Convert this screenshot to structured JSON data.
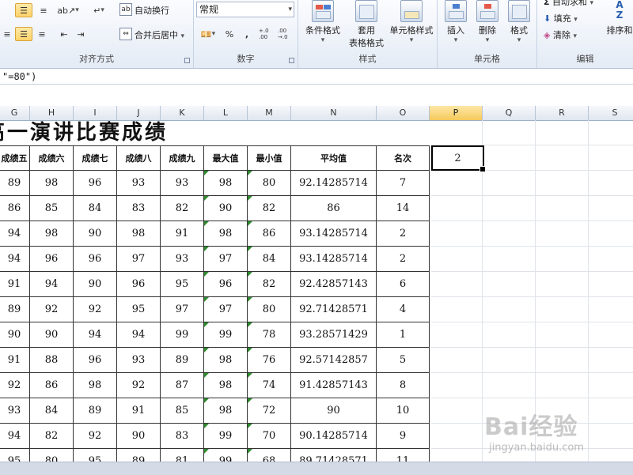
{
  "ribbon": {
    "alignment": {
      "wrap_text": "自动换行",
      "merge_center": "合并后居中",
      "group_label": "对齐方式"
    },
    "number": {
      "format_value": "常规",
      "percent": "%",
      "comma": ",",
      "inc_decimal": "+.0 .00",
      "dec_decimal": ".00 →.0",
      "group_label": "数字"
    },
    "styles": {
      "conditional_format": "条件格式",
      "format_as_table_line1": "套用",
      "format_as_table_line2": "表格格式",
      "cell_styles": "单元格样式",
      "group_label": "样式"
    },
    "cells": {
      "insert": "插入",
      "delete": "删除",
      "format": "格式",
      "group_label": "单元格"
    },
    "editing": {
      "autosum": "自动求和",
      "fill": "填充",
      "clear": "清除",
      "sort_filter": "排序和",
      "group_label": "编辑"
    }
  },
  "formula_bar": {
    "text": "\"=80\")"
  },
  "column_headers": [
    "G",
    "H",
    "I",
    "J",
    "K",
    "L",
    "M",
    "N",
    "O",
    "P",
    "Q",
    "R",
    "S"
  ],
  "active_column": "P",
  "sheet": {
    "title": "高一演讲比赛成绩",
    "headers": [
      "成绩五",
      "成绩六",
      "成绩七",
      "成绩八",
      "成绩九",
      "最大值",
      "最小值",
      "平均值",
      "名次"
    ],
    "rows": [
      [
        "89",
        "98",
        "96",
        "93",
        "93",
        "98",
        "80",
        "92.14285714",
        "7"
      ],
      [
        "86",
        "85",
        "84",
        "83",
        "82",
        "90",
        "82",
        "86",
        "14"
      ],
      [
        "94",
        "98",
        "90",
        "98",
        "91",
        "98",
        "86",
        "93.14285714",
        "2"
      ],
      [
        "94",
        "96",
        "96",
        "97",
        "93",
        "97",
        "84",
        "93.14285714",
        "2"
      ],
      [
        "91",
        "94",
        "90",
        "96",
        "95",
        "96",
        "82",
        "92.42857143",
        "6"
      ],
      [
        "89",
        "92",
        "92",
        "95",
        "97",
        "97",
        "80",
        "92.71428571",
        "4"
      ],
      [
        "90",
        "90",
        "94",
        "94",
        "99",
        "99",
        "78",
        "93.28571429",
        "1"
      ],
      [
        "91",
        "88",
        "96",
        "93",
        "89",
        "98",
        "76",
        "92.57142857",
        "5"
      ],
      [
        "92",
        "86",
        "98",
        "92",
        "87",
        "98",
        "74",
        "91.42857143",
        "8"
      ],
      [
        "93",
        "84",
        "89",
        "91",
        "85",
        "98",
        "72",
        "90",
        "10"
      ],
      [
        "94",
        "82",
        "92",
        "90",
        "83",
        "99",
        "70",
        "90.14285714",
        "9"
      ],
      [
        "95",
        "80",
        "95",
        "89",
        "81",
        "99",
        "68",
        "89.71428571",
        "11"
      ]
    ],
    "active_cell_value": "2"
  },
  "watermark": {
    "logo": "Bai经验",
    "url": "jingyan.baidu.com"
  },
  "colors": {
    "ribbon_top": "#fbfcfe",
    "ribbon_bottom": "#e4ebf5",
    "selected_button": "#ffd36a",
    "active_header": "#f5c95b",
    "error_triangle": "#2e8b2e"
  }
}
